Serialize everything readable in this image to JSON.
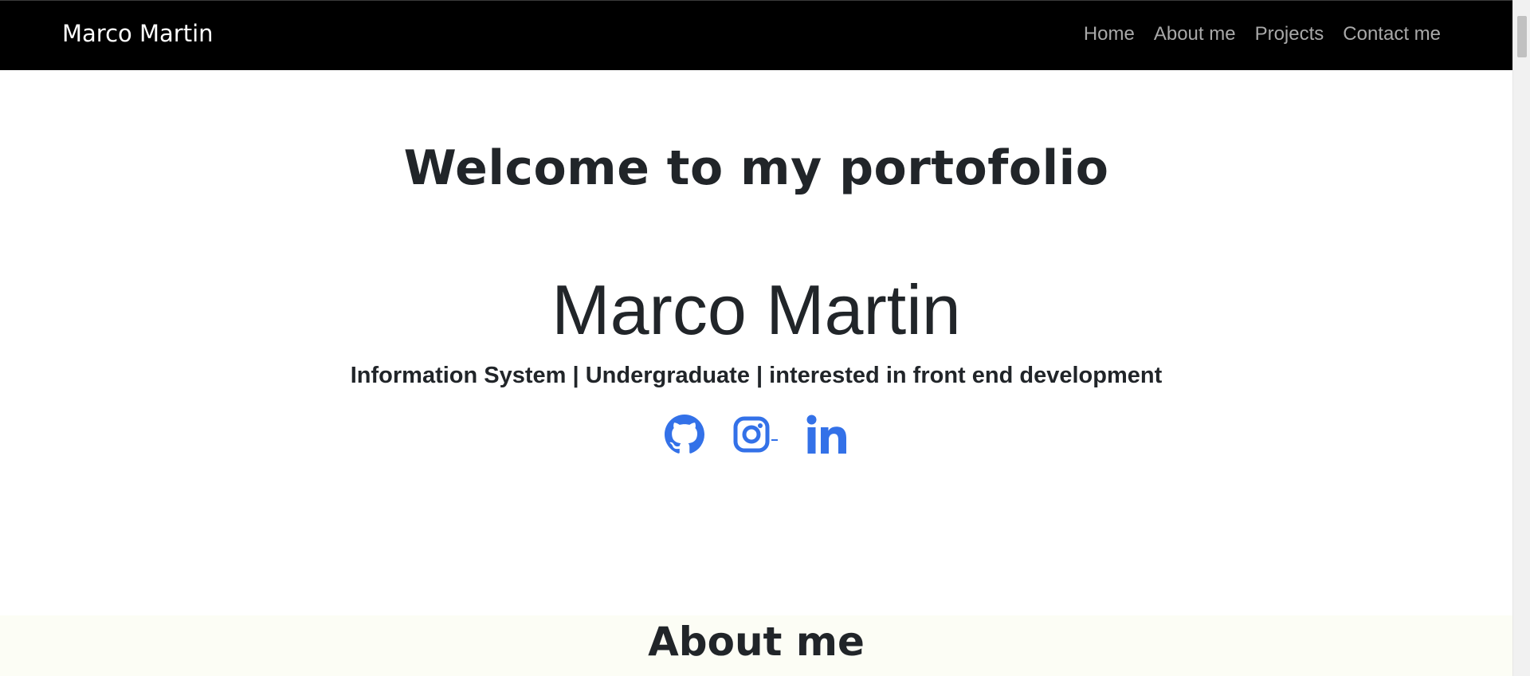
{
  "navbar": {
    "brand": "Marco Martin",
    "links": [
      {
        "label": "Home"
      },
      {
        "label": "About me"
      },
      {
        "label": "Projects"
      },
      {
        "label": "Contact me"
      }
    ]
  },
  "hero": {
    "title": "Welcome to my portofolio",
    "name": "Marco Martin",
    "subtitle": "Information System | Undergraduate | interested in front end development"
  },
  "socials": [
    {
      "icon": "github-icon"
    },
    {
      "icon": "instagram-icon"
    },
    {
      "icon": "linkedin-icon"
    }
  ],
  "about": {
    "title": "About me"
  },
  "colors": {
    "navbar_bg": "#000000",
    "brand": "#ffffff",
    "nav_link": "#a8a8a8",
    "text": "#212529",
    "icon_accent": "#3371e8",
    "about_bg": "#fcfdf5"
  }
}
